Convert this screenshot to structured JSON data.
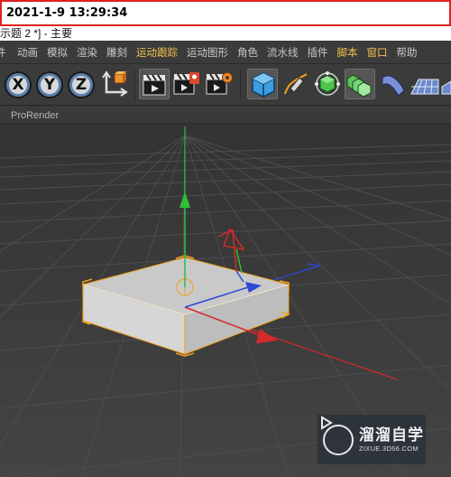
{
  "timestamp": "2021-1-9 13:29:34",
  "window_title": "示题 2 *] - 主要",
  "menu": {
    "items": [
      {
        "label": "件",
        "active": false
      },
      {
        "label": "动画",
        "active": false
      },
      {
        "label": "模拟",
        "active": false
      },
      {
        "label": "渲染",
        "active": false
      },
      {
        "label": "雕刻",
        "active": false
      },
      {
        "label": "运动跟踪",
        "active": true
      },
      {
        "label": "运动图形",
        "active": false
      },
      {
        "label": "角色",
        "active": false
      },
      {
        "label": "流水线",
        "active": false
      },
      {
        "label": "插件",
        "active": false
      },
      {
        "label": "脚本",
        "active": true
      },
      {
        "label": "窗口",
        "active": true
      },
      {
        "label": "帮助",
        "active": false
      }
    ]
  },
  "toolbar": {
    "axis_x": "X",
    "axis_y": "Y",
    "axis_z": "Z"
  },
  "viewport": {
    "tab_label": "ProRender"
  },
  "watermark": {
    "name": "溜溜自学",
    "url": "ZIXUE.3D66.COM"
  },
  "colors": {
    "accent_menu": "#f2c14e",
    "timestamp_border": "#e02020",
    "x_axis": "#d42a2a",
    "y_axis": "#2fbf3a",
    "z_axis": "#2a4ad8",
    "selection": "#f0a020"
  }
}
